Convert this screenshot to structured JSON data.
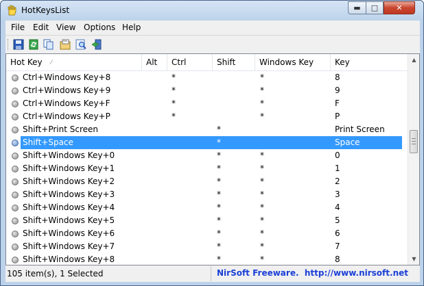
{
  "window": {
    "title": "HotKeysList"
  },
  "menu": [
    "File",
    "Edit",
    "View",
    "Options",
    "Help"
  ],
  "toolbar": {
    "icons": [
      "save-icon",
      "refresh-icon",
      "copy-icon",
      "properties-icon",
      "find-icon",
      "exit-icon"
    ]
  },
  "columns": [
    "Hot Key",
    "Alt",
    "Ctrl",
    "Shift",
    "Windows Key",
    "Key"
  ],
  "rows": [
    {
      "hotkey": "Ctrl+Windows Key+8",
      "alt": "",
      "ctrl": "*",
      "shift": "",
      "win": "*",
      "key": "8",
      "selected": false
    },
    {
      "hotkey": "Ctrl+Windows Key+9",
      "alt": "",
      "ctrl": "*",
      "shift": "",
      "win": "*",
      "key": "9",
      "selected": false
    },
    {
      "hotkey": "Ctrl+Windows Key+F",
      "alt": "",
      "ctrl": "*",
      "shift": "",
      "win": "*",
      "key": "F",
      "selected": false
    },
    {
      "hotkey": "Ctrl+Windows Key+P",
      "alt": "",
      "ctrl": "*",
      "shift": "",
      "win": "*",
      "key": "P",
      "selected": false
    },
    {
      "hotkey": "Shift+Print Screen",
      "alt": "",
      "ctrl": "",
      "shift": "*",
      "win": "",
      "key": "Print Screen",
      "selected": false
    },
    {
      "hotkey": "Shift+Space",
      "alt": "",
      "ctrl": "",
      "shift": "*",
      "win": "",
      "key": "Space",
      "selected": true
    },
    {
      "hotkey": "Shift+Windows Key+0",
      "alt": "",
      "ctrl": "",
      "shift": "*",
      "win": "*",
      "key": "0",
      "selected": false
    },
    {
      "hotkey": "Shift+Windows Key+1",
      "alt": "",
      "ctrl": "",
      "shift": "*",
      "win": "*",
      "key": "1",
      "selected": false
    },
    {
      "hotkey": "Shift+Windows Key+2",
      "alt": "",
      "ctrl": "",
      "shift": "*",
      "win": "*",
      "key": "2",
      "selected": false
    },
    {
      "hotkey": "Shift+Windows Key+3",
      "alt": "",
      "ctrl": "",
      "shift": "*",
      "win": "*",
      "key": "3",
      "selected": false
    },
    {
      "hotkey": "Shift+Windows Key+4",
      "alt": "",
      "ctrl": "",
      "shift": "*",
      "win": "*",
      "key": "4",
      "selected": false
    },
    {
      "hotkey": "Shift+Windows Key+5",
      "alt": "",
      "ctrl": "",
      "shift": "*",
      "win": "*",
      "key": "5",
      "selected": false
    },
    {
      "hotkey": "Shift+Windows Key+6",
      "alt": "",
      "ctrl": "",
      "shift": "*",
      "win": "*",
      "key": "6",
      "selected": false
    },
    {
      "hotkey": "Shift+Windows Key+7",
      "alt": "",
      "ctrl": "",
      "shift": "*",
      "win": "*",
      "key": "7",
      "selected": false
    },
    {
      "hotkey": "Shift+Windows Key+8",
      "alt": "",
      "ctrl": "",
      "shift": "*",
      "win": "*",
      "key": "8",
      "selected": false
    }
  ],
  "status": {
    "count": "105 item(s), 1 Selected",
    "credit": "NirSoft Freeware.  http://www.nirsoft.net"
  },
  "colors": {
    "selection": "#3399ff",
    "credit_link": "#1a3fd6"
  }
}
